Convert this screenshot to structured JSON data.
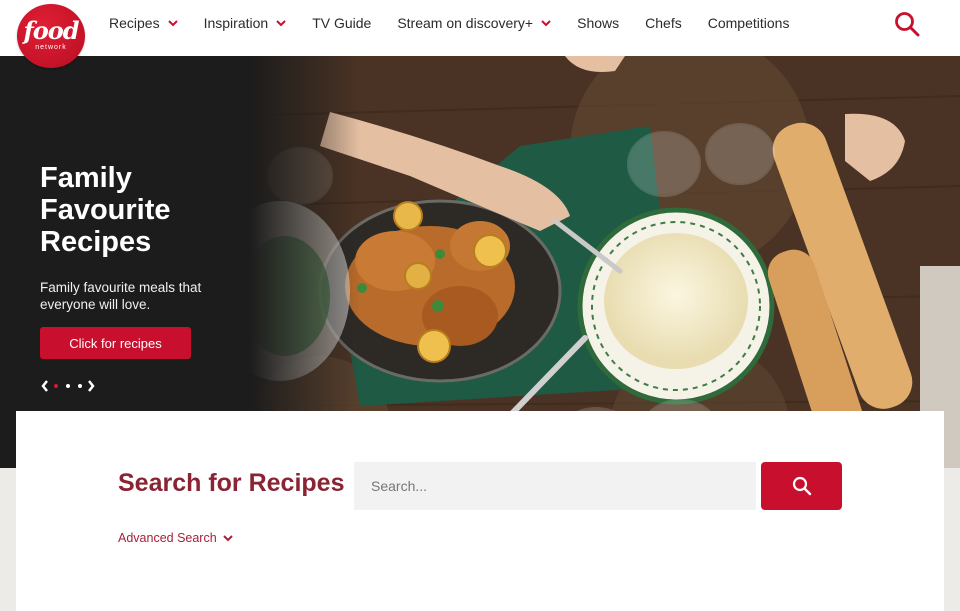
{
  "brand": {
    "logo_word": "food",
    "logo_sub": "network"
  },
  "nav": {
    "items": [
      {
        "label": "Recipes",
        "dropdown": true
      },
      {
        "label": "Inspiration",
        "dropdown": true
      },
      {
        "label": "TV Guide",
        "dropdown": false
      },
      {
        "label": "Stream on discovery+",
        "dropdown": true
      },
      {
        "label": "Shows",
        "dropdown": false
      },
      {
        "label": "Chefs",
        "dropdown": false
      },
      {
        "label": "Competitions",
        "dropdown": false
      }
    ],
    "search_icon": "search-icon"
  },
  "hero": {
    "title_lines": [
      "Family",
      "Favourite",
      "Recipes"
    ],
    "description": "Family favourite meals that everyone will love.",
    "button_label": "Click for recipes",
    "carousel": {
      "prev": "‹",
      "next": "›",
      "slides": 3,
      "active_slide": 1
    }
  },
  "search": {
    "title": "Search for Recipes",
    "placeholder": "Search...",
    "value": "",
    "advanced_label": "Advanced Search"
  },
  "colors": {
    "brand_red": "#c8102e",
    "title_maroon": "#8a2333",
    "link_red": "#a8203a"
  }
}
